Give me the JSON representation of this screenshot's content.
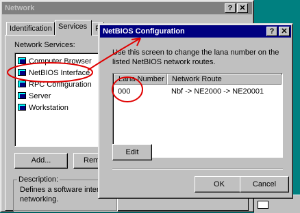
{
  "network_window": {
    "title": "Network",
    "help_btn": "?",
    "close_btn": "✕",
    "tabs": [
      "Identification",
      "Services",
      "P"
    ],
    "services_label": "Network Services:",
    "services": [
      "Computer Browser",
      "NetBIOS Interface",
      "RPC Configuration",
      "Server",
      "Workstation"
    ],
    "add_button": "Add...",
    "remove_button": "Remo",
    "description_label": "Description:",
    "description_line1": "Defines a software interf",
    "description_line2": "networking."
  },
  "netbios_dialog": {
    "title": "NetBIOS Configuration",
    "help_btn": "?",
    "close_btn": "✕",
    "description_line1": "Use this screen to change the lana number on the",
    "description_line2": "listed NetBIOS network routes.",
    "columns": [
      "Lana Number",
      "Network Route"
    ],
    "rows": [
      {
        "lana": "000",
        "route": "Nbf -> NE2000 -> NE20001"
      }
    ],
    "edit_button": "Edit",
    "ok_button": "OK",
    "cancel_button": "Cancel"
  },
  "colors": {
    "desktop": "#008080",
    "inactive_title": "#808080",
    "active_title": "#000080",
    "annotation": "#e00000"
  }
}
